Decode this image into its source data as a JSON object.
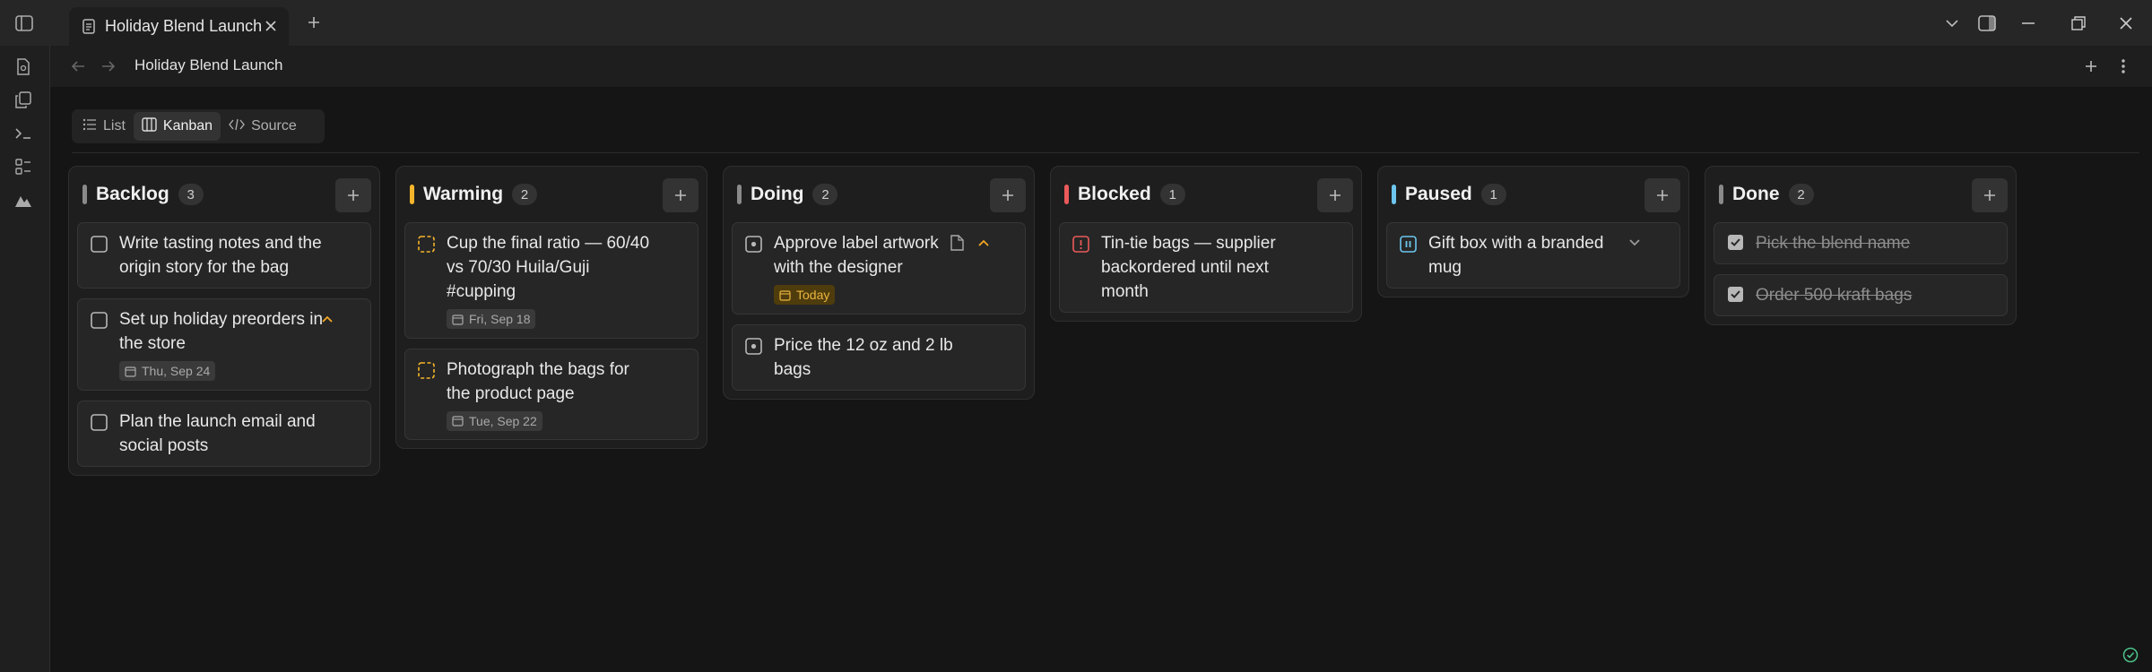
{
  "tab": {
    "title": "Holiday Blend Launch"
  },
  "nav": {
    "title": "Holiday Blend Launch"
  },
  "views": [
    {
      "label": "List",
      "icon": "list-icon",
      "active": false
    },
    {
      "label": "Kanban",
      "icon": "kanban-icon",
      "active": true
    },
    {
      "label": "Source",
      "icon": "code-icon",
      "active": false
    }
  ],
  "colors": {
    "backlog": "#8a8a8a",
    "warming": "#f5b52a",
    "doing": "#8a8a8a",
    "blocked": "#ea5a5a",
    "paused": "#6cc6ee",
    "done": "#8a8a8a",
    "today_bg": "#4f3c0d",
    "today_fg": "#e9b53f"
  },
  "columns": [
    {
      "name": "Backlog",
      "count": "3",
      "cards": [
        {
          "title": "Write tasting notes and the origin story for the bag",
          "status": "todo"
        },
        {
          "title": "Set up holiday preorders in the store",
          "status": "todo",
          "date": "Thu, Sep 24",
          "priority": "high"
        },
        {
          "title": "Plan the launch email and social posts",
          "status": "todo"
        }
      ]
    },
    {
      "name": "Warming",
      "count": "2",
      "cards": [
        {
          "title": "Cup the final ratio — 60/40 vs 70/30 Huila/Guji #cupping",
          "status": "warming",
          "date": "Fri, Sep 18"
        },
        {
          "title": "Photograph the bags for the product page",
          "status": "warming",
          "date": "Tue, Sep 22"
        }
      ]
    },
    {
      "name": "Doing",
      "count": "2",
      "cards": [
        {
          "title": "Approve label artwork with the designer",
          "status": "doing",
          "date": "Today",
          "has_note": true,
          "priority": "high"
        },
        {
          "title": "Price the 12 oz and 2 lb bags",
          "status": "doing"
        }
      ]
    },
    {
      "name": "Blocked",
      "count": "1",
      "cards": [
        {
          "title": "Tin-tie bags — supplier backordered until next month",
          "status": "blocked"
        }
      ]
    },
    {
      "name": "Paused",
      "count": "1",
      "cards": [
        {
          "title": "Gift box with a branded mug",
          "status": "paused",
          "priority": "low"
        }
      ]
    },
    {
      "name": "Done",
      "count": "2",
      "cards": [
        {
          "title": "Pick the blend name",
          "status": "done"
        },
        {
          "title": "Order 500 kraft bags",
          "status": "done"
        }
      ]
    }
  ]
}
